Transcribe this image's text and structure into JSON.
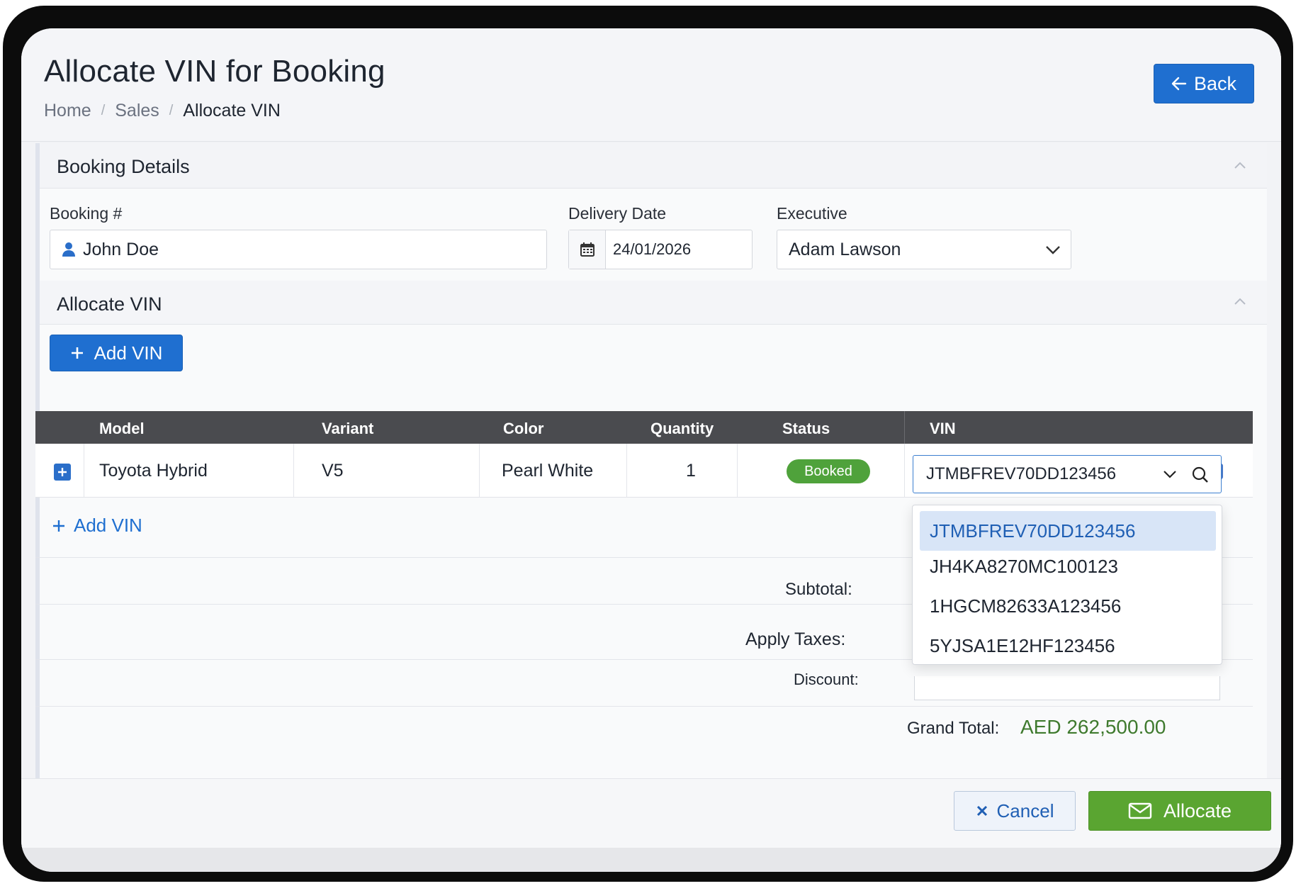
{
  "page": {
    "title": "Allocate VIN for Booking",
    "breadcrumb": [
      "Home",
      "Sales",
      "Allocate VIN"
    ],
    "back_label": "Back"
  },
  "booking_details": {
    "section_title": "Booking Details",
    "booking_label": "Booking #",
    "booking_value": "John Doe",
    "delivery_label": "Delivery Date",
    "delivery_value": "24/01/2026",
    "executive_label": "Executive",
    "executive_value": "Adam Lawson"
  },
  "allocate": {
    "section_title": "Allocate VIN",
    "add_vin_button": "Add VIN",
    "add_vin_link": "Add VIN"
  },
  "table": {
    "headers": [
      "Model",
      "Variant",
      "Color",
      "Quantity",
      "Status",
      "VIN"
    ],
    "row": {
      "model": "Toyota Hybrid",
      "variant": "V5",
      "color": "Pearl White",
      "quantity": "1",
      "status": "Booked",
      "vin": "JTMBFREV70DD123456"
    }
  },
  "vin_dropdown": {
    "options": [
      "JTMBFREV70DD123456",
      "JH4KA8270MC100123",
      "1HGCM82633A123456",
      "5YJSA1E12HF123456"
    ],
    "selected_index": 0
  },
  "summary": {
    "subtotal_label": "Subtotal:",
    "taxes_label": "Apply Taxes:",
    "discount_label": "Discount:",
    "grand_total_label": "Grand Total:",
    "grand_total_value": "AED 262,500.00"
  },
  "footer": {
    "cancel_label": "Cancel",
    "allocate_label": "Allocate"
  },
  "colors": {
    "primary": "#1f6fd0",
    "success": "#5aa531",
    "badge": "#4fa23b",
    "grand_total": "#3f7a2e"
  }
}
